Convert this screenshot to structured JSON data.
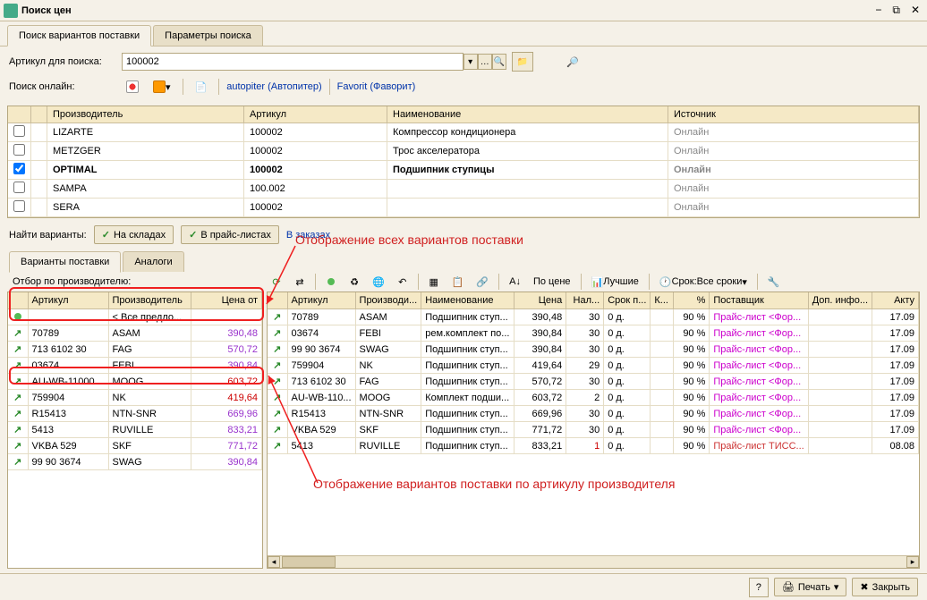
{
  "window": {
    "title": "Поиск цен"
  },
  "tabs": {
    "main": [
      "Поиск вариантов поставки",
      "Параметры поиска"
    ]
  },
  "search": {
    "label": "Артикул для поиска:",
    "value": "100002",
    "online_label": "Поиск онлайн:",
    "autopiter": "autopiter (Автопитер)",
    "favorit": "Favorit (Фаворит)"
  },
  "grid1": {
    "headers": {
      "mfr": "Производитель",
      "art": "Артикул",
      "name": "Наименование",
      "src": "Источник"
    },
    "rows": [
      {
        "chk": false,
        "mfr": "LIZARTE",
        "art": "100002",
        "name": "Компрессор кондиционера",
        "src": "Онлайн",
        "sel": false
      },
      {
        "chk": false,
        "mfr": "METZGER",
        "art": "100002",
        "name": "Трос акселератора",
        "src": "Онлайн",
        "sel": false
      },
      {
        "chk": true,
        "mfr": "OPTIMAL",
        "art": "100002",
        "name": "Подшипник ступицы",
        "src": "Онлайн",
        "sel": true
      },
      {
        "chk": false,
        "mfr": "SAMPA",
        "art": "100.002",
        "name": "",
        "src": "Онлайн",
        "sel": false
      },
      {
        "chk": false,
        "mfr": "SERA",
        "art": "100002",
        "name": "",
        "src": "Онлайн",
        "sel": false
      }
    ]
  },
  "find": {
    "label": "Найти варианты:",
    "stock": "На складах",
    "price": "В прайс-листах",
    "orders": "В заказах"
  },
  "subtabs": [
    "Варианты поставки",
    "Аналоги"
  ],
  "filter_label": "Отбор по производителю:",
  "callouts": {
    "c1": "Отображение всех вариантов поставки",
    "c2": "Отображение вариантов поставки по артикулу производителя"
  },
  "toolbar2": {
    "by_price": "По цене",
    "best": "Лучшие",
    "term_label": "Срок:",
    "term_value": "Все сроки"
  },
  "left_grid": {
    "headers": {
      "art": "Артикул",
      "mfr": "Производитель",
      "price": "Цена от"
    },
    "rows": [
      {
        "art": "",
        "mfr": "< Все предло...",
        "price": "",
        "dot": true
      },
      {
        "art": "70789",
        "mfr": "ASAM",
        "price": "390,48",
        "cls": "price-purple"
      },
      {
        "art": "713 6102 30",
        "mfr": "FAG",
        "price": "570,72",
        "cls": "price-purple"
      },
      {
        "art": "03674",
        "mfr": "FEBI",
        "price": "390,84",
        "cls": "price-purple"
      },
      {
        "art": "AU-WB-11000",
        "mfr": "MOOG",
        "price": "603,72",
        "cls": "price-red"
      },
      {
        "art": "759904",
        "mfr": "NK",
        "price": "419,64",
        "cls": "price-red"
      },
      {
        "art": "R15413",
        "mfr": "NTN-SNR",
        "price": "669,96",
        "cls": "price-purple"
      },
      {
        "art": "5413",
        "mfr": "RUVILLE",
        "price": "833,21",
        "cls": "price-purple"
      },
      {
        "art": "VKBA 529",
        "mfr": "SKF",
        "price": "771,72",
        "cls": "price-purple"
      },
      {
        "art": "99 90 3674",
        "mfr": "SWAG",
        "price": "390,84",
        "cls": "price-purple"
      }
    ]
  },
  "right_grid": {
    "headers": {
      "art": "Артикул",
      "mfr": "Производи...",
      "name": "Наименование",
      "price": "Цена",
      "stock": "Нал...",
      "term": "Срок п...",
      "k": "К...",
      "pct": "%",
      "supplier": "Поставщик",
      "extra": "Доп. инфо...",
      "act": "Акту"
    },
    "rows": [
      {
        "art": "70789",
        "mfr": "ASAM",
        "name": "Подшипник ступ...",
        "price": "390,48",
        "stock": "30",
        "term": "0 д.",
        "pct": "90 %",
        "supplier": "Прайс-лист <Фор...",
        "act": "17.09",
        "scls": "supplier"
      },
      {
        "art": "03674",
        "mfr": "FEBI",
        "name": "рем.комплект по...",
        "price": "390,84",
        "stock": "30",
        "term": "0 д.",
        "pct": "90 %",
        "supplier": "Прайс-лист <Фор...",
        "act": "17.09",
        "scls": "supplier"
      },
      {
        "art": "99 90 3674",
        "mfr": "SWAG",
        "name": "Подшипник ступ...",
        "price": "390,84",
        "stock": "30",
        "term": "0 д.",
        "pct": "90 %",
        "supplier": "Прайс-лист <Фор...",
        "act": "17.09",
        "scls": "supplier"
      },
      {
        "art": "759904",
        "mfr": "NK",
        "name": "Подшипник ступ...",
        "price": "419,64",
        "stock": "29",
        "term": "0 д.",
        "pct": "90 %",
        "supplier": "Прайс-лист <Фор...",
        "act": "17.09",
        "scls": "supplier"
      },
      {
        "art": "713 6102 30",
        "mfr": "FAG",
        "name": "Подшипник ступ...",
        "price": "570,72",
        "stock": "30",
        "term": "0 д.",
        "pct": "90 %",
        "supplier": "Прайс-лист <Фор...",
        "act": "17.09",
        "scls": "supplier"
      },
      {
        "art": "AU-WB-110...",
        "mfr": "MOOG",
        "name": "Комплект подши...",
        "price": "603,72",
        "stock": "2",
        "term": "0 д.",
        "pct": "90 %",
        "supplier": "Прайс-лист <Фор...",
        "act": "17.09",
        "scls": "supplier"
      },
      {
        "art": "R15413",
        "mfr": "NTN-SNR",
        "name": "Подшипник ступ...",
        "price": "669,96",
        "stock": "30",
        "term": "0 д.",
        "pct": "90 %",
        "supplier": "Прайс-лист <Фор...",
        "act": "17.09",
        "scls": "supplier"
      },
      {
        "art": "VKBA 529",
        "mfr": "SKF",
        "name": "Подшипник ступ...",
        "price": "771,72",
        "stock": "30",
        "term": "0 д.",
        "pct": "90 %",
        "supplier": "Прайс-лист <Фор...",
        "act": "17.09",
        "scls": "supplier"
      },
      {
        "art": "5413",
        "mfr": "RUVILLE",
        "name": "Подшипник ступ...",
        "price": "833,21",
        "stock": "1",
        "term": "0 д.",
        "pct": "90 %",
        "supplier": "Прайс-лист ТИСС...",
        "act": "08.08",
        "scls": "supplier-red",
        "stockcls": "price-red"
      }
    ]
  },
  "footer": {
    "print": "Печать",
    "close": "Закрыть"
  }
}
